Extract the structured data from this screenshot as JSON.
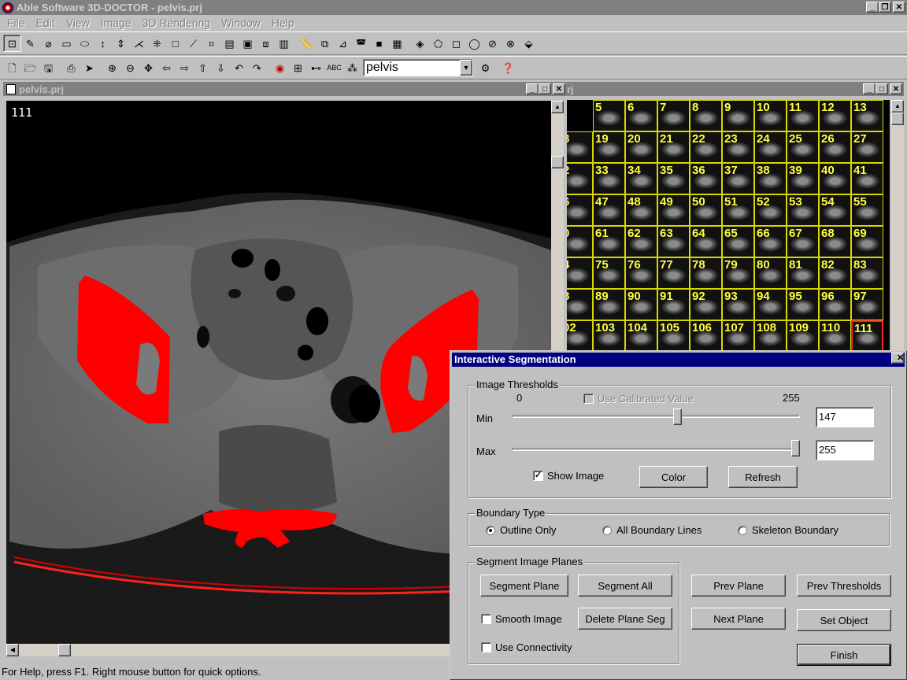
{
  "app": {
    "title": "Able Software 3D-DOCTOR - pelvis.prj"
  },
  "menu": [
    "File",
    "Edit",
    "View",
    "Image",
    "3D Rendering",
    "Window",
    "Help"
  ],
  "toolbar": {
    "project_value": "pelvis"
  },
  "image_window": {
    "title": "pelvis.prj",
    "slice_number": "111"
  },
  "thumb_window": {
    "title_fragment": "rj",
    "rows": [
      [
        "5",
        "6",
        "7",
        "8",
        "9",
        "10",
        "11",
        "12",
        "13"
      ],
      [
        "8",
        "19",
        "20",
        "21",
        "22",
        "23",
        "24",
        "25",
        "26",
        "27"
      ],
      [
        "2",
        "33",
        "34",
        "35",
        "36",
        "37",
        "38",
        "39",
        "40",
        "41"
      ],
      [
        "6",
        "47",
        "48",
        "49",
        "50",
        "51",
        "52",
        "53",
        "54",
        "55"
      ],
      [
        "0",
        "61",
        "62",
        "63",
        "64",
        "65",
        "66",
        "67",
        "68",
        "69"
      ],
      [
        "4",
        "75",
        "76",
        "77",
        "78",
        "79",
        "80",
        "81",
        "82",
        "83"
      ],
      [
        "8",
        "89",
        "90",
        "91",
        "92",
        "93",
        "94",
        "95",
        "96",
        "97"
      ],
      [
        "02",
        "103",
        "104",
        "105",
        "106",
        "107",
        "108",
        "109",
        "110",
        "111"
      ]
    ],
    "selected": "111"
  },
  "dialog": {
    "title": "Interactive Segmentation",
    "thresholds": {
      "group_label": "Image Thresholds",
      "range_min_label": "0",
      "range_max_label": "255",
      "use_calibrated_label": "Use Calibrated Value",
      "min_label": "Min",
      "max_label": "Max",
      "min_value": "147",
      "max_value": "255",
      "min_level": 147,
      "max_level": 255,
      "show_image_label": "Show Image",
      "color_label": "Color",
      "refresh_label": "Refresh"
    },
    "boundary": {
      "group_label": "Boundary Type",
      "outline_only": "Outline Only",
      "all_lines": "All Boundary Lines",
      "skeleton": "Skeleton Boundary"
    },
    "segment": {
      "group_label": "Segment Image Planes",
      "segment_plane": "Segment Plane",
      "segment_all": "Segment All",
      "smooth_image": "Smooth Image",
      "delete_plane_seg": "Delete Plane Seg",
      "use_connectivity": "Use Connectivity"
    },
    "nav": {
      "prev_plane": "Prev Plane",
      "prev_thresholds": "Prev Thresholds",
      "next_plane": "Next Plane",
      "set_object": "Set Object",
      "finish": "Finish"
    }
  },
  "status": {
    "text": "For Help, press F1. Right mouse button for quick options."
  },
  "colors": {
    "segmentation": "#ff0000",
    "thumb_label": "#ffff40",
    "active_title": "#000080"
  }
}
